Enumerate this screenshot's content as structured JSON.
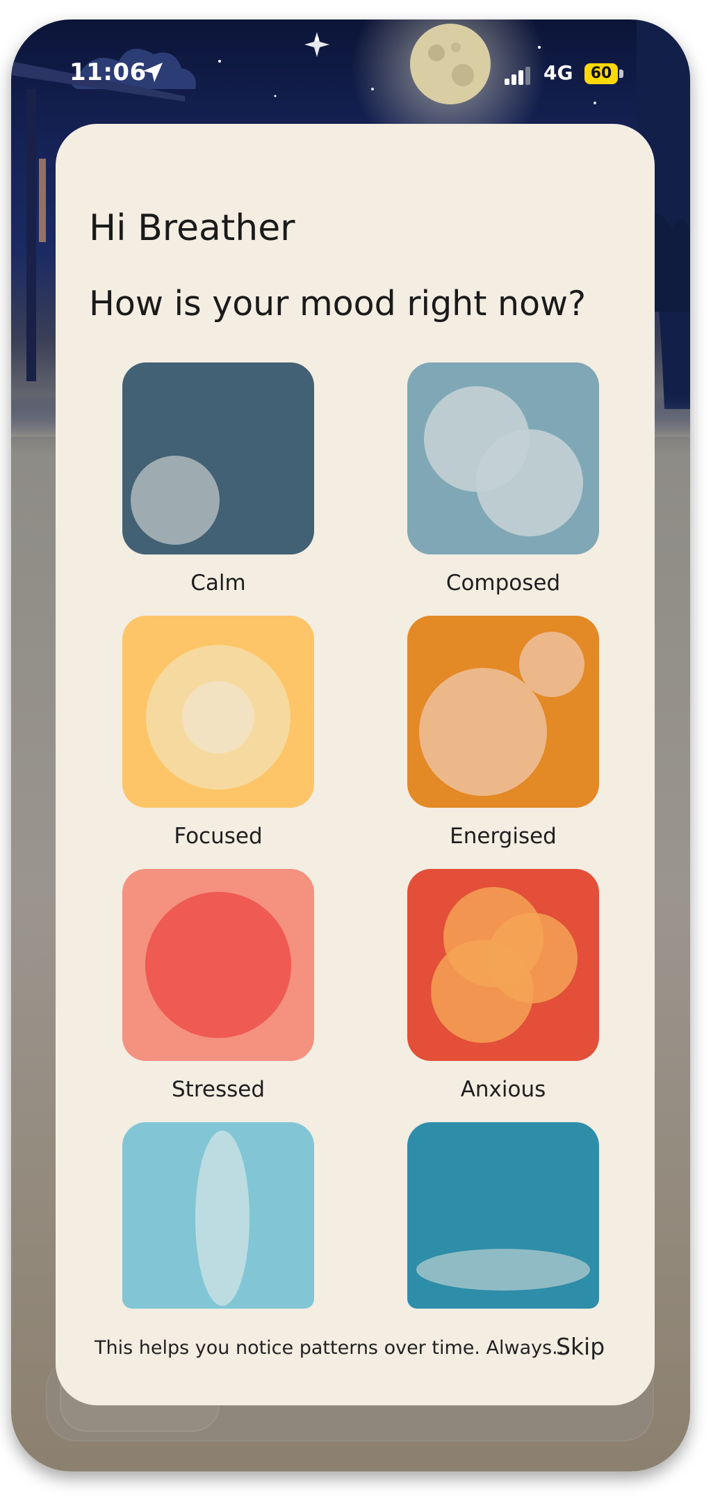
{
  "status_bar": {
    "time": "11:06",
    "network": "4G",
    "battery": "60"
  },
  "colors": {
    "sheet_bg": "#f3ede2",
    "calm": "#426174",
    "composed": "#80a7b6",
    "focused": "#fdc567",
    "energised": "#e38926",
    "stressed": "#f4917f",
    "anxious": "#e34f38",
    "light_blue": "#82c6d5",
    "teal": "#2e8ea9"
  },
  "sheet": {
    "greeting": "Hi Breather",
    "question": "How is your mood right now?",
    "moods": [
      {
        "label": "Calm",
        "icon": "calm-mood-icon"
      },
      {
        "label": "Composed",
        "icon": "composed-mood-icon"
      },
      {
        "label": "Focused",
        "icon": "focused-mood-icon"
      },
      {
        "label": "Energised",
        "icon": "energised-mood-icon"
      },
      {
        "label": "Stressed",
        "icon": "stressed-mood-icon"
      },
      {
        "label": "Anxious",
        "icon": "anxious-mood-icon"
      },
      {
        "label": "",
        "icon": "vertical-ellipse-mood-icon"
      },
      {
        "label": "",
        "icon": "horizontal-ellipse-mood-icon"
      }
    ],
    "footer_note": "This helps you notice patterns over time. Always...",
    "skip_label": "Skip"
  },
  "tab_bar": {
    "icons": [
      "home-tab-icon",
      "library-tab-icon",
      "calendar-tab-icon",
      "profile-tab-icon"
    ]
  }
}
